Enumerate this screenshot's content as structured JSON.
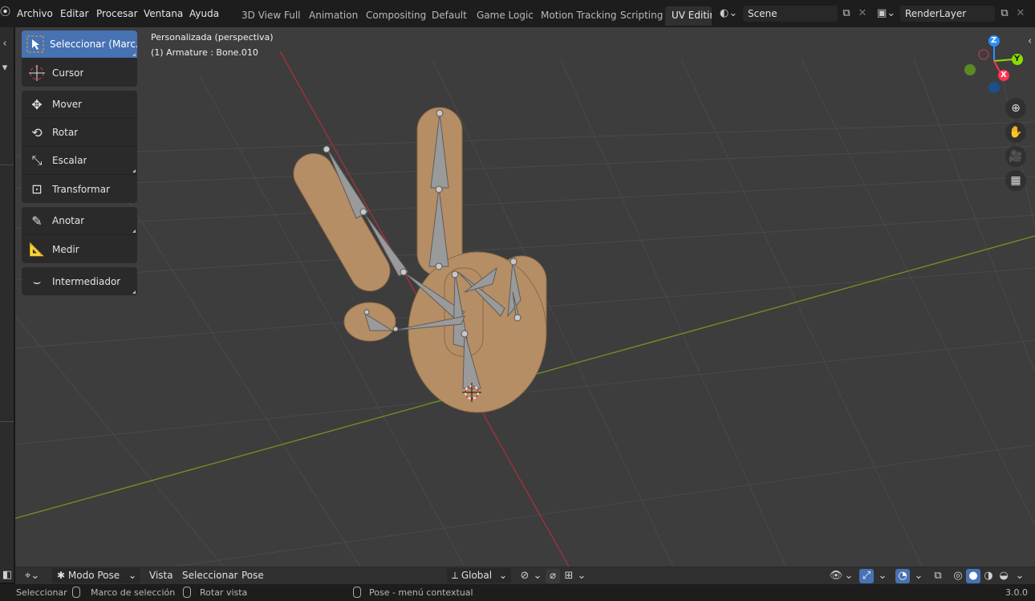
{
  "menu": [
    "Archivo",
    "Editar",
    "Procesar",
    "Ventana",
    "Ayuda"
  ],
  "workspaces": [
    "3D View Full",
    "Animation",
    "Compositing",
    "Default",
    "Game Logic",
    "Motion Tracking",
    "Scripting",
    "UV Editing"
  ],
  "active_workspace": "UV Editing",
  "scene_field": "Scene",
  "layer_field": "RenderLayer",
  "viewport": {
    "view_name": "Personalizada (perspectiva)",
    "object_info": "(1) Armature : Bone.010"
  },
  "gizmo_axes": [
    "X",
    "Y",
    "Z"
  ],
  "toolbar": {
    "groups": [
      [
        {
          "label": "Seleccionar (Marc...",
          "icon": "select-box-icon",
          "active": true
        },
        {
          "label": "Cursor",
          "icon": "cursor-icon"
        }
      ],
      [
        {
          "label": "Mover",
          "icon": "move-icon"
        },
        {
          "label": "Rotar",
          "icon": "rotate-icon"
        },
        {
          "label": "Escalar",
          "icon": "scale-icon"
        },
        {
          "label": "Transformar",
          "icon": "transform-icon"
        }
      ],
      [
        {
          "label": "Anotar",
          "icon": "annotate-icon"
        },
        {
          "label": "Medir",
          "icon": "measure-icon"
        }
      ],
      [
        {
          "label": "Intermediador",
          "icon": "breakdowner-icon"
        }
      ]
    ]
  },
  "header_bottom": {
    "mode": "Modo Pose",
    "menus": [
      "Vista",
      "Seleccionar",
      "Pose"
    ],
    "orientation": "Global"
  },
  "status": {
    "left_action": "Seleccionar",
    "middle_action": "Marco de selección",
    "right_action": "Rotar vista",
    "context": "Pose - menú contextual",
    "version": "3.0.0"
  },
  "colors": {
    "active_tool": "#4772b3",
    "axis_x": "#ff3352",
    "axis_y": "#8bdc00",
    "axis_z": "#2890ff",
    "hand": "#b58e65",
    "bone": "#999999"
  }
}
